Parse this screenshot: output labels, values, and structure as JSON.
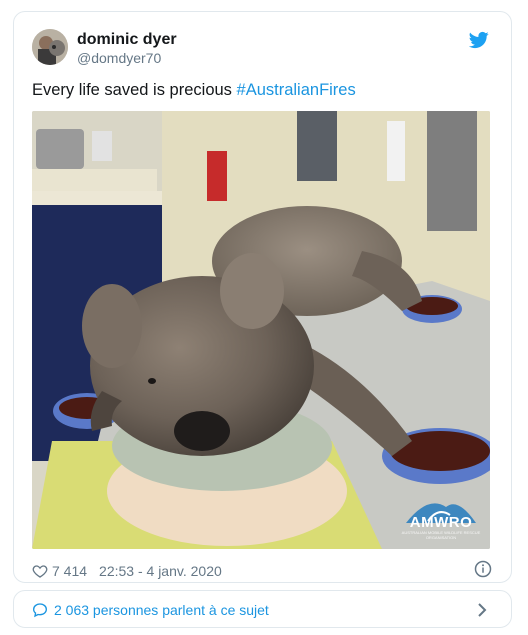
{
  "tweet": {
    "display_name": "dominic dyer",
    "handle": "@domdyer70",
    "text_plain": "Every life saved is precious ",
    "hashtag": "#AustralianFires",
    "likes": "7 414",
    "timestamp": "22:53 - 4 janv. 2020"
  },
  "media": {
    "logo_text": "AMWRO",
    "logo_subtext": "AUSTRALIAN MOBILE WILDLIFE RESCUE ORGANISATION"
  },
  "conversation": {
    "label": "2 063 personnes parlent à ce sujet"
  },
  "icons": {
    "brand": "twitter-bird-icon",
    "like": "heart-icon",
    "info": "info-icon",
    "conversation": "speech-bubble-icon",
    "more": "chevron-right-icon"
  },
  "colors": {
    "link": "#1b95e0",
    "muted": "#657786",
    "text": "#14171a",
    "border": "#e1e8ed",
    "twitter_blue": "#1da1f2"
  }
}
